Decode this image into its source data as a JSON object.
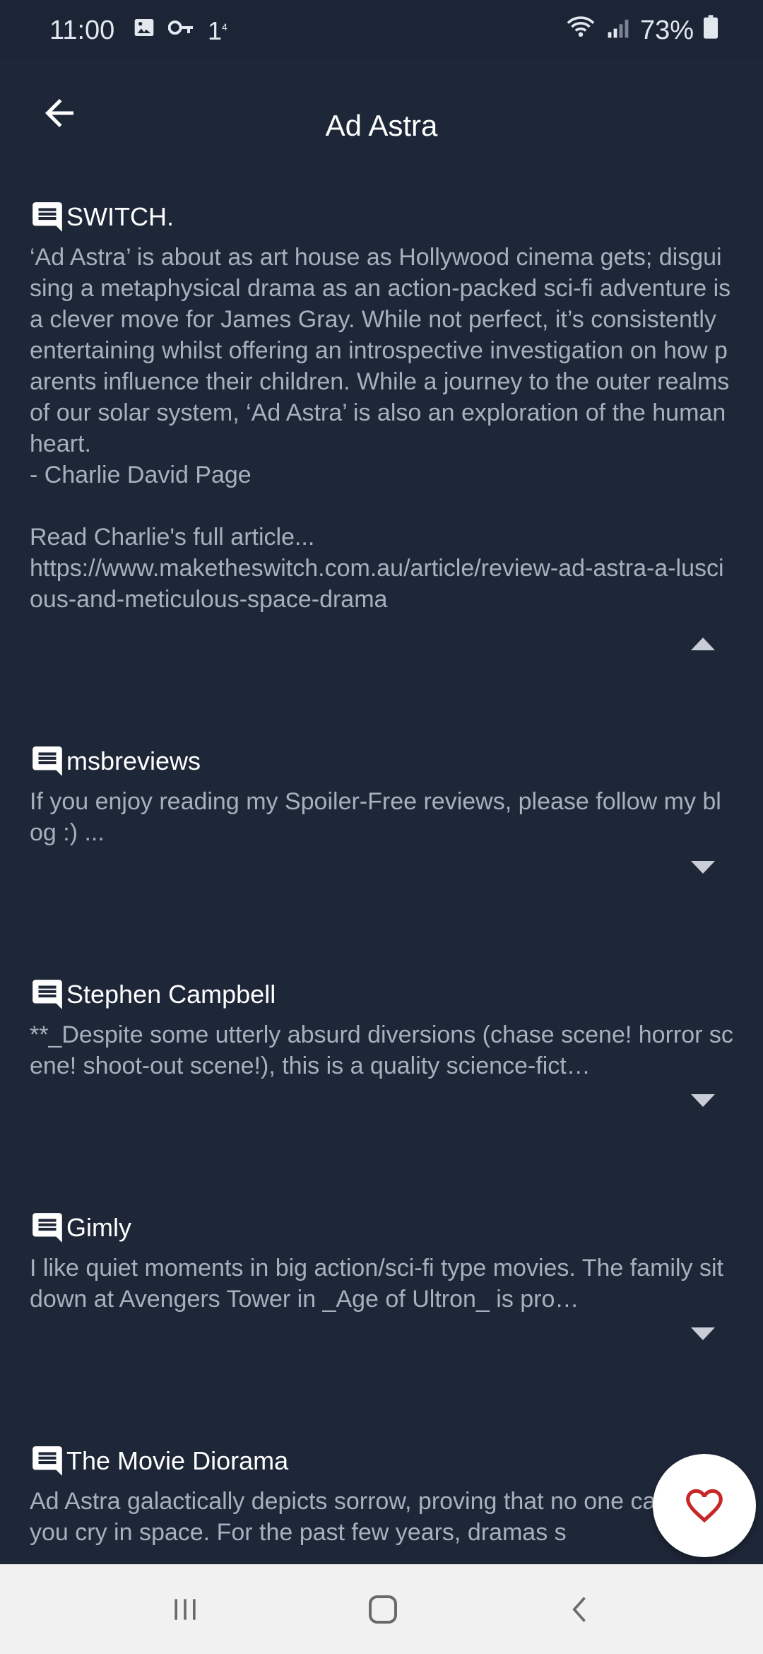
{
  "status_bar": {
    "time": "11:00",
    "notification_icons": [
      "image-icon",
      "key-icon",
      "data-icon"
    ],
    "data_indicator": "1",
    "battery_percent": "73%"
  },
  "app_bar": {
    "title": "Ad Astra"
  },
  "reviews": [
    {
      "author": "SWITCH.",
      "text": "‘Ad Astra’ is about as art house as Hollywood cinema gets; disguising a metaphysical drama as an action-packed sci-fi adventure is a clever move for James Gray. While not perfect, it’s consistently entertaining whilst offering an introspective investigation on how parents influence their children. While a journey to the outer realms of our solar system, ‘Ad Astra’ is also an exploration of the human heart.\n- Charlie David Page\n\nRead Charlie's full article...\nhttps://www.maketheswitch.com.au/article/review-ad-astra-a-luscious-and-meticulous-space-drama",
      "expanded": true
    },
    {
      "author": "msbreviews",
      "text": "If you enjoy reading my Spoiler-Free reviews, please follow my blog :) ...",
      "expanded": false
    },
    {
      "author": "Stephen Campbell",
      "text": "**_Despite some utterly absurd diversions (chase scene! horror scene! shoot-out scene!), this is a quality science-fict…",
      "expanded": false
    },
    {
      "author": "Gimly",
      "text": "I like quiet moments in big action/sci-fi type movies. The family sitdown at Avengers Tower in _Age of Ultron_ is pro…",
      "expanded": false
    },
    {
      "author": "The Movie Diorama",
      "text": "Ad Astra galactically depicts sorrow, proving that no one can hear you cry in space. For the past few years, dramas s",
      "expanded": false
    }
  ],
  "fab": {
    "icon": "heart-outline-icon",
    "color": "#c62828"
  },
  "nav_bar": {
    "icons": [
      "recent-apps-icon",
      "home-icon",
      "back-icon"
    ]
  },
  "colors": {
    "background": "#1e2738",
    "author": "#ffffff",
    "review_text": "#a8b0bd",
    "nav_bar": "#f1f1f1"
  }
}
